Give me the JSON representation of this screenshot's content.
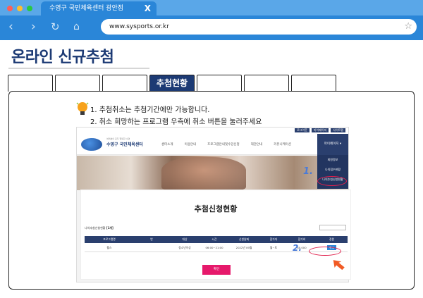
{
  "browser": {
    "tab_title": "수영구 국민체육센터 광안점",
    "tab_close": "X",
    "url": "www.sysports.or.kr"
  },
  "page": {
    "title": "온라인 신규추첨",
    "active_tab": "추첨현황",
    "instructions": [
      "1. 추첨취소는 추첨기간에만 가능합니다.",
      "2. 취소 희망하는 프로그램 우측에 취소 버튼을 눌러주세요"
    ]
  },
  "site": {
    "top_links": [
      "로그아웃",
      "마이페이지",
      "사이트맵"
    ],
    "logo_sub": "여러분이 모두 행복한 수영",
    "logo_name": "수영구 국민체육센터",
    "gnb": [
      "센터소개",
      "이용안내",
      "프로그램안내및수강신청",
      "대관안내",
      "커뮤니케이션"
    ],
    "mypage": "마이페이지 ▾",
    "dropdown": [
      "회원정보",
      "나의접수현황",
      "나의추첨신청현황"
    ],
    "panel_title": "추첨신청현황",
    "list_label": "나의추첨신청현황",
    "list_count": "[1개]",
    "right_button": "",
    "table_headers": [
      "프로그램명",
      "반",
      "대상",
      "시간",
      "신청날짜",
      "참가자",
      "참가비",
      "정원"
    ],
    "table_row": [
      "헬스",
      "",
      "청소년이상",
      "06:00~21:00",
      "2022년 09월",
      "월~토",
      "40,000",
      "취소"
    ],
    "bottom_button": "확인"
  },
  "annotations": {
    "step1": "1.",
    "step2": "2."
  },
  "colors": {
    "browser_blue": "#2a86d8",
    "title_navy": "#1c3a74",
    "highlight_red": "#e0204c",
    "arrow_orange": "#f15a24"
  }
}
